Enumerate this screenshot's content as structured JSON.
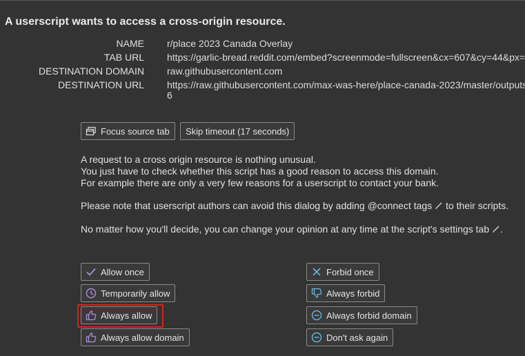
{
  "dialog": {
    "title": "A userscript wants to access a cross-origin resource."
  },
  "info": {
    "name_label": "NAME",
    "name_value": "r/place 2023 Canada Overlay",
    "tab_url_label": "TAB URL",
    "tab_url_value": "https://garlic-bread.reddit.com/embed?screenmode=fullscreen&cx=607&cy=44&px=34",
    "dest_domain_label": "DESTINATION DOMAIN",
    "dest_domain_value": "raw.githubusercontent.com",
    "dest_url_label": "DESTINATION URL",
    "dest_url_value": "https://raw.githubusercontent.com/max-was-here/place-canada-2023/master/outputs",
    "dest_url_wrap": "6"
  },
  "top_buttons": {
    "focus_source_tab": "Focus source tab",
    "skip_timeout": "Skip timeout (17 seconds)"
  },
  "message": {
    "line1": "A request to a cross origin resource is nothing unusual.",
    "line2": "You just have to check whether this script has a good reason to access this domain.",
    "line3": "For example there are only a very few reasons for a userscript to contact your bank.",
    "line4": "Please note that userscript authors can avoid this dialog by adding @connect tags",
    "line4_tail": " to their scripts.",
    "line5": "No matter how you'll decide, you can change your opinion at any time at the script's settings tab",
    "line5_tail": "."
  },
  "actions": {
    "allow_once": "Allow once",
    "temporarily_allow": "Temporarily allow",
    "always_allow": "Always allow",
    "always_allow_domain": "Always allow domain",
    "forbid_once": "Forbid once",
    "always_forbid": "Always forbid",
    "always_forbid_domain": "Always forbid domain",
    "dont_ask_again": "Don't ask again"
  },
  "colors": {
    "background": "#333333",
    "allow_icon": "#a98fd6",
    "forbid_icon": "#67b7e0",
    "highlight": "#d9221c"
  }
}
